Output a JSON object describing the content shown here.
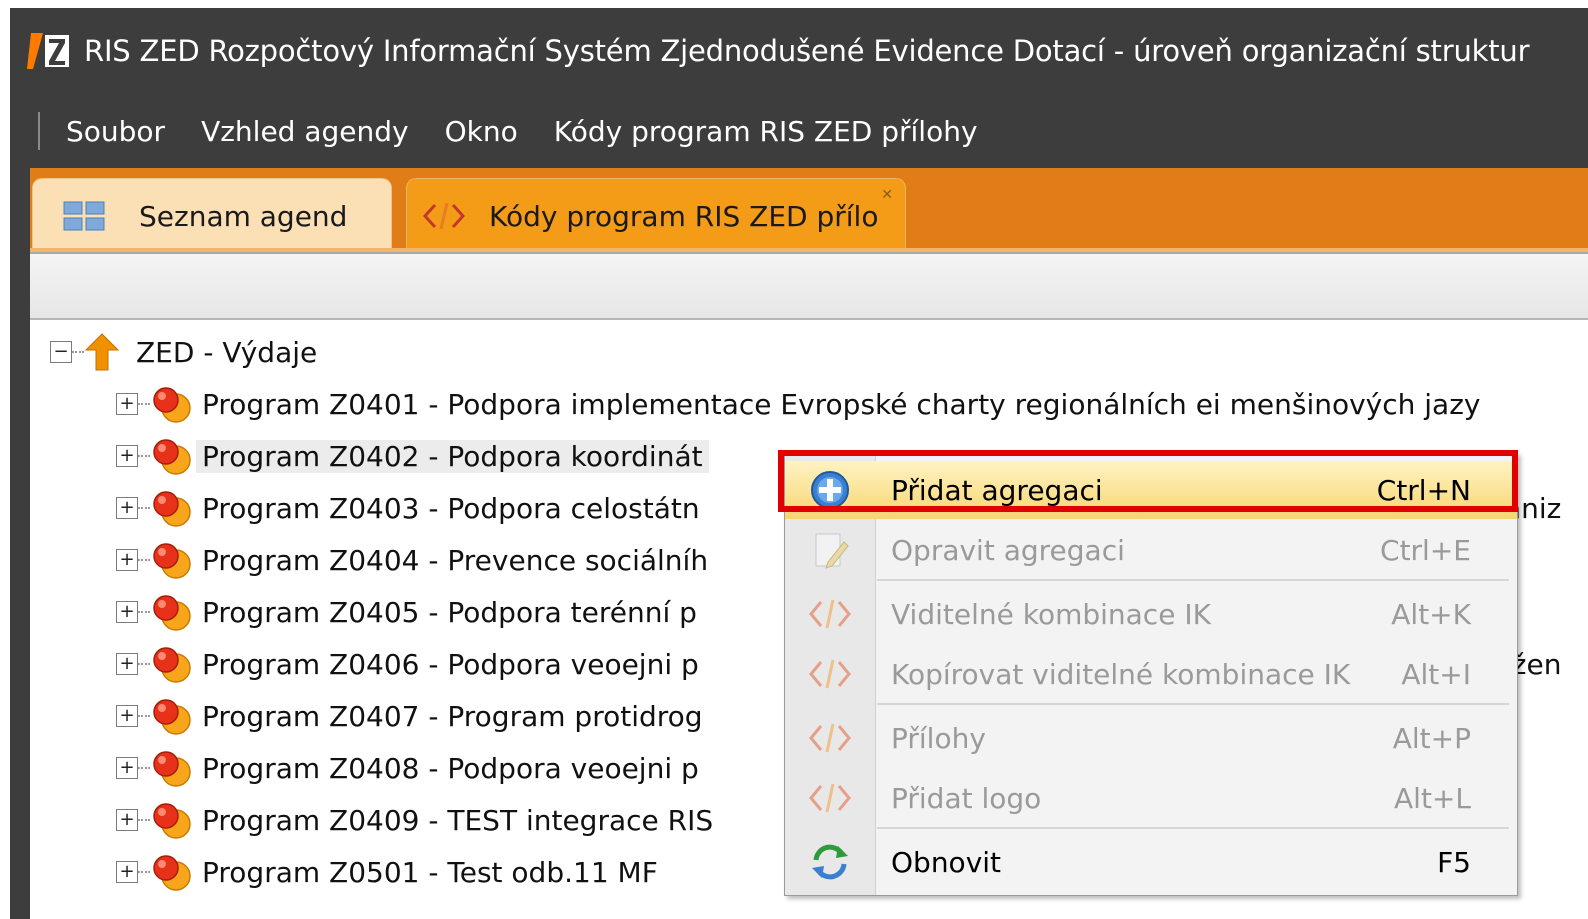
{
  "window": {
    "title": "RIS ZED Rozpočtový Informační Systém Zjednodušené Evidence Dotací - úroveň organizační struktur",
    "logo_icon": "ris-zed-logo"
  },
  "menubar": {
    "items": [
      {
        "label": "Soubor"
      },
      {
        "label": "Vzhled agendy"
      },
      {
        "label": "Okno"
      },
      {
        "label": "Kódy program RIS ZED přílohy"
      }
    ]
  },
  "tabs": [
    {
      "label": "Seznam agend",
      "icon": "grid-icon"
    },
    {
      "label": "Kódy program RIS ZED přílo",
      "icon": "code-icon",
      "active": true
    }
  ],
  "tree": {
    "root": {
      "label": "ZED - Výdaje",
      "icon": "arrow-up-icon"
    },
    "items": [
      {
        "label": "Program Z0401 - Podpora implementace Evropské charty regionálních ei menšinových jazy"
      },
      {
        "label": "Program Z0402 - Podpora koordinát"
      },
      {
        "label": "Program Z0403 - Podpora celostátn",
        "right_text": "aniz"
      },
      {
        "label": "Program Z0404 - Prevence sociálníh"
      },
      {
        "label": "Program Z0405 - Podpora terénní p"
      },
      {
        "label": "Program Z0406 - Podpora veoejni p",
        "right_text": "ižen"
      },
      {
        "label": "Program Z0407 - Program protidrog"
      },
      {
        "label": "Program Z0408 - Podpora veoejni p"
      },
      {
        "label": "Program Z0409 - TEST integrace RIS"
      },
      {
        "label": "Program Z0501 - Test odb.11 MF"
      }
    ]
  },
  "context_menu": {
    "items": [
      {
        "label": "Přidat agregaci",
        "shortcut": "Ctrl+N",
        "icon": "add-circle-icon",
        "state": "highlighted"
      },
      {
        "label": "Opravit agregaci",
        "shortcut": "Ctrl+E",
        "icon": "edit-icon",
        "state": "disabled"
      },
      {
        "label": "Viditelné kombinace IK",
        "shortcut": "Alt+K",
        "icon": "code-icon",
        "state": "disabled"
      },
      {
        "label": "Kopírovat viditelné kombinace IK",
        "shortcut": "Alt+I",
        "icon": "code-icon",
        "state": "disabled"
      },
      {
        "label": "Přílohy",
        "shortcut": "Alt+P",
        "icon": "code-icon",
        "state": "disabled"
      },
      {
        "label": "Přidat logo",
        "shortcut": "Alt+L",
        "icon": "code-icon",
        "state": "disabled"
      },
      {
        "label": "Obnovit",
        "shortcut": "F5",
        "icon": "refresh-icon",
        "state": "enabled"
      }
    ]
  },
  "colors": {
    "titlebar": "#3d3d3d",
    "tabstrip": "#e07d17",
    "active_tab": "#f49b17",
    "highlight_box": "#e00000"
  }
}
